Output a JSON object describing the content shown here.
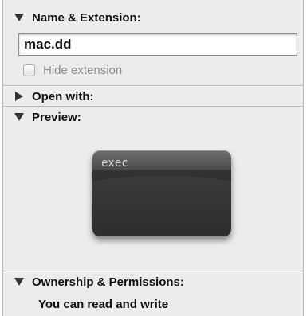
{
  "sections": {
    "name_extension": {
      "title": "Name & Extension:",
      "expanded": true,
      "name_value": "mac.dd",
      "hide_extension": {
        "label": "Hide extension",
        "checked": false,
        "enabled": false
      }
    },
    "open_with": {
      "title": "Open with:",
      "expanded": false
    },
    "preview": {
      "title": "Preview:",
      "expanded": true,
      "icon_label": "exec"
    },
    "ownership": {
      "title": "Ownership & Permissions:",
      "expanded": true,
      "summary": "You can read and write"
    }
  },
  "icons": {
    "expanded": "disclosure-triangle-down-icon",
    "collapsed": "disclosure-triangle-right-icon"
  }
}
